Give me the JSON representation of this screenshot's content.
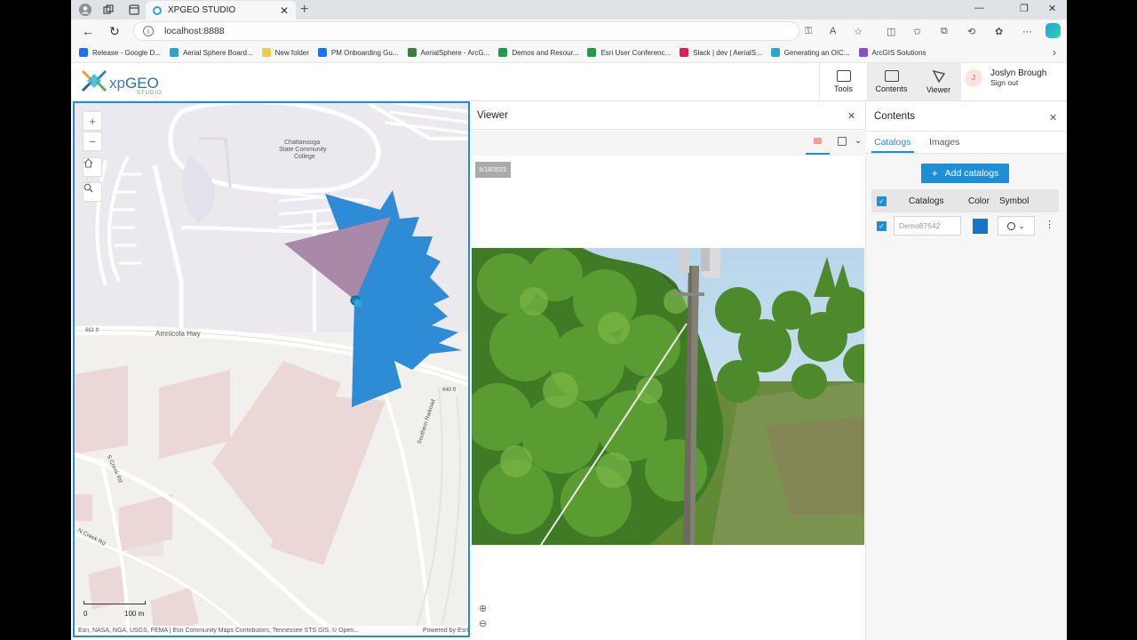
{
  "browser": {
    "tab_title": "XPGEO STUDIO",
    "url": "localhost:8888",
    "bookmarks": [
      {
        "label": "Release - Google D...",
        "color": "#1a73e8"
      },
      {
        "label": "Aerial Sphere Board...",
        "color": "#2aa6c9"
      },
      {
        "label": "New folder",
        "color": "#f2c94c"
      },
      {
        "label": "PM Onboarding Gu...",
        "color": "#1a73e8"
      },
      {
        "label": "AerialSphere - ArcG...",
        "color": "#3a7f3a"
      },
      {
        "label": "Demos and Resour...",
        "color": "#1e9c4a"
      },
      {
        "label": "Esri User Conferenc...",
        "color": "#1e9c4a"
      },
      {
        "label": "Slack | dev | AerialS...",
        "color": "#e01e5a"
      },
      {
        "label": "Generating an OIC...",
        "color": "#2aa6c9"
      },
      {
        "label": "ArcGIS Solutions",
        "color": "#8a4fc7"
      }
    ]
  },
  "header": {
    "brand_prefix": "xp",
    "brand_name": "GEO",
    "brand_sub": "STUDIO",
    "tools_label": "Tools",
    "contents_label": "Contents",
    "viewer_label": "Viewer",
    "user_initial": "J",
    "user_name": "Joslyn Brough",
    "sign_out": "Sign out"
  },
  "map": {
    "labels": {
      "college_1": "Chattanooga",
      "college_2": "State Community",
      "college_3": "College",
      "road_1": "Amnicola Hwy",
      "elev_1": "661 ft",
      "elev_2": "640 ft",
      "road_2": "Southern Railroad",
      "road_3": "S Creek Rd",
      "road_4": "N Creek Rd"
    },
    "scale_zero": "0",
    "scale_label": "100 m",
    "attribution": "Esri, NASA, NGA, USGS, FEMA | Esri Community Maps Contributors, Tennessee STS GIS, © Open...",
    "powered_by": "Powered by Esri",
    "colors": {
      "coverage": "#2e8bd6",
      "view_cone": "#a88aa8",
      "land": "#f1f0ec",
      "buildings": "#ead7d6",
      "roads": "#ffffff"
    }
  },
  "viewer": {
    "title": "Viewer",
    "date_badge": "5/18/2022"
  },
  "contents": {
    "title": "Contents",
    "tab_catalogs": "Catalogs",
    "tab_images": "Images",
    "add_button": "Add catalogs",
    "col_catalogs": "Catalogs",
    "col_color": "Color",
    "col_symbol": "Symbol",
    "row_name_placeholder": "Demo87642",
    "row_color": "#1a73c6"
  },
  "icons": [
    "back-icon",
    "refresh-icon",
    "info-icon",
    "plus-icon",
    "minus-icon",
    "home-icon",
    "search-icon",
    "close-icon",
    "zoom-in-icon",
    "zoom-out-icon",
    "chevron-down-icon",
    "kebab-icon"
  ]
}
